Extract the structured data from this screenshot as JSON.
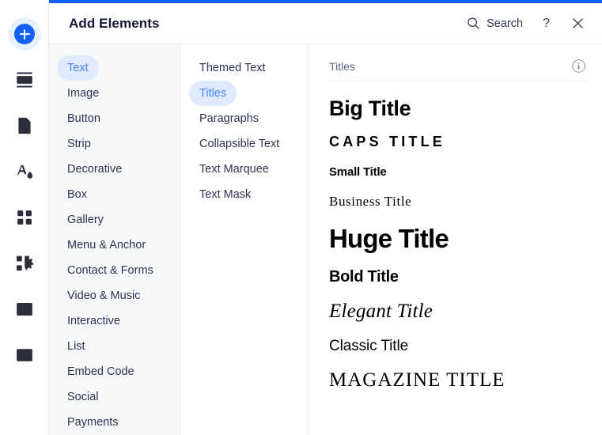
{
  "colors": {
    "accent_blue": "#1161f7",
    "pill_bg": "#dfeaff",
    "pill_text": "#4c83ff",
    "sidebar_bg": "#f7f8f9",
    "text_dark": "#2e3354",
    "title_dark": "#131738",
    "muted": "#5f6582"
  },
  "icon_rail": {
    "add_button": {
      "icon": "plus-icon",
      "label": "Add"
    },
    "items": [
      {
        "icon": "sections-icon",
        "label": "Add Section"
      },
      {
        "icon": "pages-icon",
        "label": "Pages"
      },
      {
        "icon": "theme-icon",
        "label": "Site Theme"
      },
      {
        "icon": "apps-icon",
        "label": "Apps"
      },
      {
        "icon": "blocks-icon",
        "label": "Blocks"
      },
      {
        "icon": "media-icon",
        "label": "Media"
      },
      {
        "icon": "layouter-icon",
        "label": "Layouters"
      }
    ]
  },
  "header": {
    "title": "Add Elements",
    "search_label": "Search",
    "search_icon": "search-icon",
    "help_label": "?",
    "close_icon": "close-icon"
  },
  "categories": {
    "selected": "Text",
    "items": [
      "Text",
      "Image",
      "Button",
      "Strip",
      "Decorative",
      "Box",
      "Gallery",
      "Menu & Anchor",
      "Contact & Forms",
      "Video & Music",
      "Interactive",
      "List",
      "Embed Code",
      "Social",
      "Payments"
    ]
  },
  "subcategories": {
    "selected": "Titles",
    "items": [
      "Themed Text",
      "Titles",
      "Paragraphs",
      "Collapsible Text",
      "Text Marquee",
      "Text Mask"
    ]
  },
  "preview": {
    "header_label": "Titles",
    "info_icon": "info-icon",
    "items": [
      {
        "text": "Big Title",
        "style": "pv-big"
      },
      {
        "text": "CAPS TITLE",
        "style": "pv-caps"
      },
      {
        "text": "Small Title",
        "style": "pv-small"
      },
      {
        "text": "Business Title",
        "style": "pv-business"
      },
      {
        "text": "Huge Title",
        "style": "pv-huge"
      },
      {
        "text": "Bold Title",
        "style": "pv-bold"
      },
      {
        "text": "Elegant Title",
        "style": "pv-elegant"
      },
      {
        "text": "Classic Title",
        "style": "pv-classic"
      },
      {
        "text": "MAGAZINE TITLE",
        "style": "pv-magazine"
      }
    ]
  }
}
